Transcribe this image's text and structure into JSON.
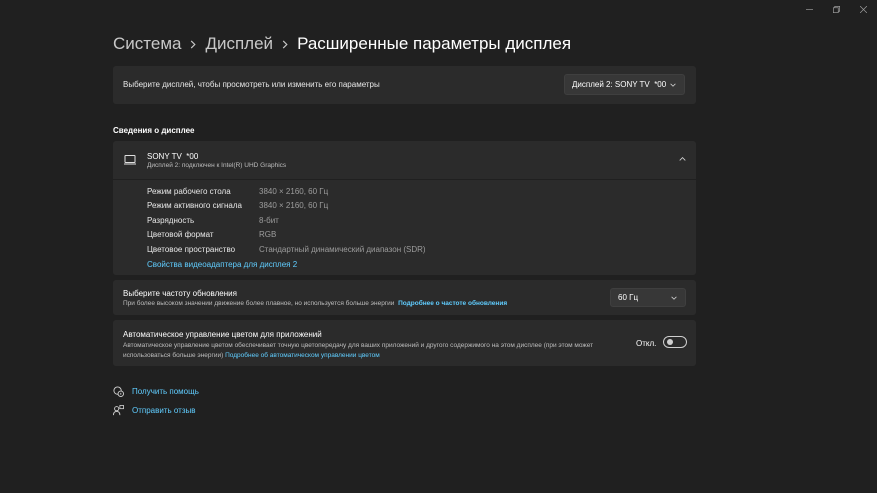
{
  "window": {
    "minimize_icon": "minimize-icon",
    "maximize_icon": "restore-icon",
    "close_icon": "close-icon"
  },
  "breadcrumb": {
    "items": [
      "Система",
      "Дисплей",
      "Расширенные параметры дисплея"
    ]
  },
  "display_select": {
    "label": "Выберите дисплей, чтобы просмотреть или изменить его параметры",
    "value": "Дисплей 2: SONY TV  *00"
  },
  "section_title": "Сведения о дисплее",
  "display_info": {
    "name": "SONY TV  *00",
    "subtitle": "Дисплей 2: подключен к Intel(R) UHD Graphics",
    "properties": [
      {
        "key": "Режим рабочего стола",
        "value": "3840 × 2160, 60 Гц"
      },
      {
        "key": "Режим активного сигнала",
        "value": "3840 × 2160, 60 Гц"
      },
      {
        "key": "Разрядность",
        "value": "8-бит"
      },
      {
        "key": "Цветовой формат",
        "value": "RGB"
      },
      {
        "key": "Цветовое пространство",
        "value": "Стандартный динамический диапазон (SDR)"
      }
    ],
    "adapter_link": "Свойства видеоадаптера для дисплея 2"
  },
  "refresh_rate": {
    "title": "Выберите частоту обновления",
    "description": "При более высоком значении движение более плавное, но используется больше энергии",
    "link": "Подробнее о частоте обновления",
    "value": "60 Гц"
  },
  "auto_color": {
    "title": "Автоматическое управление цветом для приложений",
    "description": "Автоматическое управление цветом обеспечивает точную цветопередачу для ваших приложений и другого содержимого на этом дисплее (при этом может использоваться больше энергии)",
    "link": "Подробнее об автоматическом управлении цветом",
    "toggle_label": "Откл.",
    "enabled": false
  },
  "footer": {
    "help": "Получить помощь",
    "feedback": "Отправить отзыв"
  },
  "colors": {
    "background": "#202020",
    "card": "#2b2b2b",
    "accent_link": "#60cdff"
  }
}
